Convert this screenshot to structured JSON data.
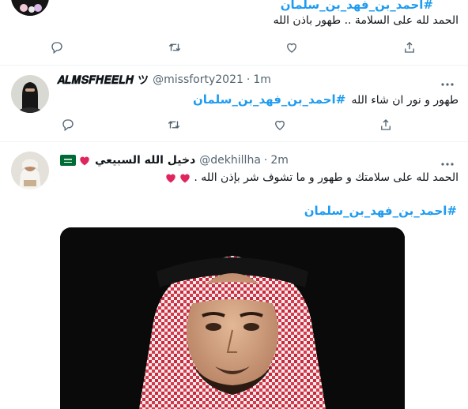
{
  "tweets": [
    {
      "hashtag": "#احمد_بن_فهد_بن_سلمان",
      "text": "الحمد لله على السلامة  ..  طهور باذن الله"
    },
    {
      "name": "𝑨𝑳𝑴𝑺𝑭𝑯𝑬𝑬𝑳𝑯 ツ",
      "handle": "@missforty2021",
      "sep": "·",
      "time": "1m",
      "text": "طهور و نور ان شاء الله",
      "hashtag": "#احمد_بن_فهد_بن_سلمان"
    },
    {
      "name": "دخيل الله السبيعي",
      "handle": "@dekhillha",
      "sep": "·",
      "time": "2m",
      "text": "الحمد لله على سلامتك و طهور و ما تشوف شر بإذن الله .",
      "hashtag": "#احمد_بن_فهد_بن_سلمان"
    }
  ],
  "icons": [
    "reply-icon",
    "retweet-icon",
    "like-icon",
    "share-icon",
    "more-icon"
  ],
  "colors": {
    "accent": "#1d9bf0",
    "text": "#0f1419",
    "muted": "#536471",
    "heart": "#e0245e",
    "flag": "#006c35"
  }
}
